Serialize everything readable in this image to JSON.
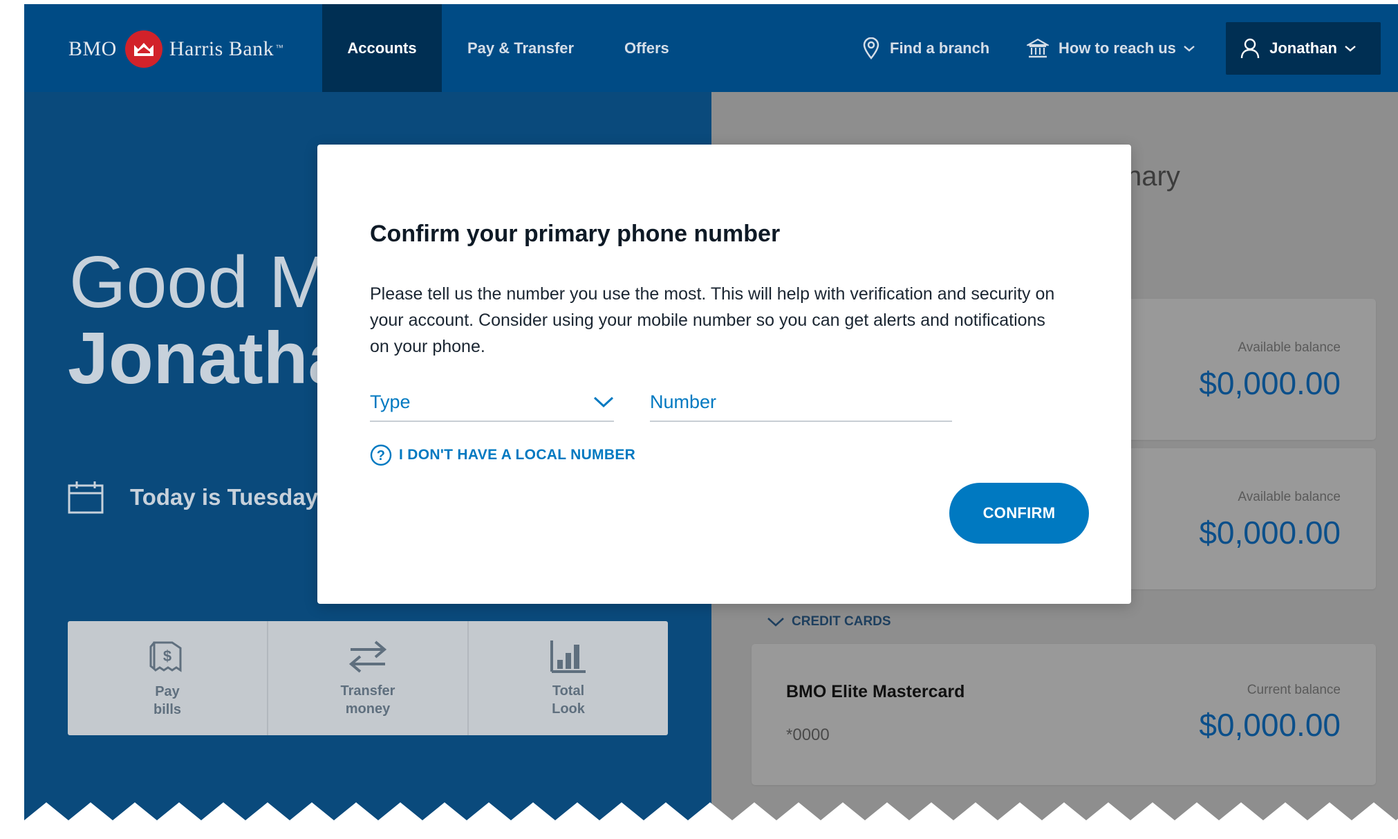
{
  "brand": {
    "left_word": "BMO",
    "right_word": "Harris Bank",
    "trademark": "™"
  },
  "nav": {
    "items": [
      {
        "label": "Accounts",
        "active": true
      },
      {
        "label": "Pay & Transfer",
        "active": false
      },
      {
        "label": "Offers",
        "active": false
      }
    ],
    "find_branch": "Find a branch",
    "reach_us": "How to reach us",
    "user": "Jonathan"
  },
  "hero": {
    "greeting_line1": "Good M",
    "greeting_line2": "Jonatha",
    "today": "Today is Tuesday,",
    "quick_actions": [
      {
        "label": "Pay\nbills",
        "icon": "bill-icon"
      },
      {
        "label": "Transfer\nmoney",
        "icon": "transfer-icon"
      },
      {
        "label": "Total\nLook",
        "icon": "bar-chart-icon"
      }
    ]
  },
  "summary": {
    "title_fragment": "nary",
    "accounts": [
      {
        "balance_label": "Available balance",
        "balance": "$0,000.00"
      },
      {
        "balance_label": "Available balance",
        "balance": "$0,000.00"
      }
    ],
    "credit_cards_header": "CREDIT CARDS",
    "credit_card": {
      "name": "BMO Elite Mastercard",
      "number": "*0000",
      "balance_label": "Current balance",
      "balance": "$0,000.00"
    }
  },
  "modal": {
    "title": "Confirm your primary phone number",
    "body": "Please tell us the number you use the most. This will help with verification and security on your account. Consider using your mobile number so you can get alerts and notifications on your phone.",
    "type_label": "Type",
    "number_placeholder": "Number",
    "no_local_link": "I DON'T HAVE A LOCAL NUMBER",
    "confirm_label": "CONFIRM"
  },
  "colors": {
    "nav_bg": "#004b85",
    "nav_active": "#002f53",
    "accent": "#0079c1",
    "logo_red": "#d2222a"
  }
}
